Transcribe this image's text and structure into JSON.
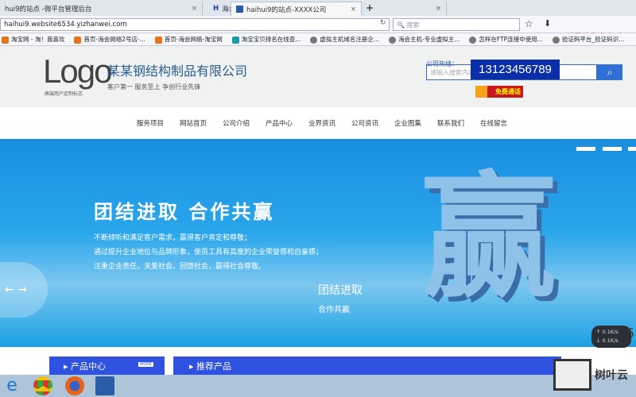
{
  "browser": {
    "tabs": [
      {
        "title": "hui9的站点 -微平台管理后台"
      },
      {
        "title": "海会网络"
      },
      {
        "title": "haihui9的站点-XXXX公司"
      }
    ],
    "url": "haihui9.website6534.yizhanwei.com",
    "search_placeholder": "搜索",
    "bookmarks": [
      "淘宝网 - 淘！我喜欢",
      "首页-海会网络2号店-...",
      "首页-海会网络-淘宝网",
      "淘宝宝贝排名在线查...",
      "虚拟主机域名注册企...",
      "海会主机-专业虚拟主...",
      "怎样在FTP连接中使用...",
      "验证码平台_验证码识..."
    ]
  },
  "overlay": {
    "recorder_text": "屏幕录像专家 未",
    "watermark": "树叶云",
    "net_up": "0.1K/s",
    "net_down": "0.1K/s",
    "badge": "5"
  },
  "header": {
    "logo": "Logo",
    "logo_sub": "高端用户定制标志",
    "company": "某某钢结构制品有限公司",
    "slogan": "客户第一 服务至上 争创行业先锋",
    "hotline_label": "公司热线：",
    "phone": "13123456789",
    "search_placeholder": "请输入搜索内容",
    "call_button": "免费通话"
  },
  "nav": [
    "服务项目",
    "网站首页",
    "公司介绍",
    "产品中心",
    "业界资讯",
    "公司资讯",
    "企业图集",
    "联系我们",
    "在线留言"
  ],
  "banner": {
    "headline": "团结进取  合作共赢",
    "lines": [
      "不断倾听和满足客户需求，赢得客户肯定和尊敬；",
      "通过提升企业地位与品牌形象，使员工具有高度的企业荣誉感和自豪感；",
      "注重企业责任，关爱社会、回馈社会，赢得社会尊敬。"
    ],
    "sub1": "团结进取",
    "sub2": "合作共赢",
    "big_char": "赢"
  },
  "sections": {
    "products": "产品中心",
    "more": "MORE",
    "recommended": "推荐产品"
  }
}
